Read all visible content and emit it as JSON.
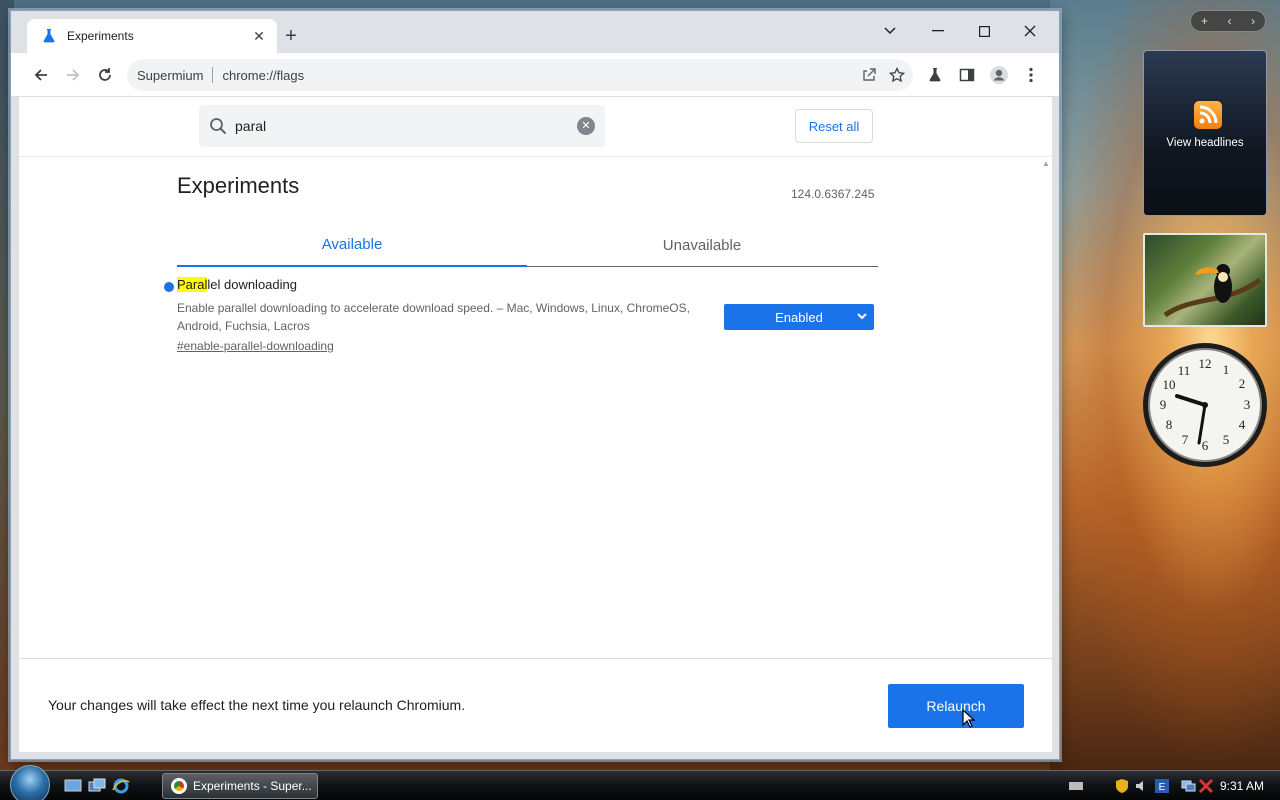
{
  "browser": {
    "tab_title": "Experiments",
    "omnibox_origin": "Supermium",
    "omnibox_url": "chrome://flags"
  },
  "flags_page": {
    "search_value": "paral",
    "reset_label": "Reset all",
    "title": "Experiments",
    "version": "124.0.6367.245",
    "tabs": [
      {
        "label": "Available",
        "active": true
      },
      {
        "label": "Unavailable",
        "active": false
      }
    ],
    "flag": {
      "name_highlight": "Paral",
      "name_rest": "lel downloading",
      "description": "Enable parallel downloading to accelerate download speed. – Mac, Windows, Linux, ChromeOS, Android, Fuchsia, Lacros",
      "link": "#enable-parallel-downloading",
      "state": "Enabled"
    },
    "footer_text": "Your changes will take effect the next time you relaunch Chromium.",
    "relaunch_label": "Relaunch"
  },
  "gadgets": {
    "feed_label": "View headlines"
  },
  "taskbar": {
    "task_label": "Experiments - Super...",
    "clock": "9:31 AM"
  },
  "colors": {
    "accent": "#1a73e8",
    "highlight": "#ffff00"
  }
}
